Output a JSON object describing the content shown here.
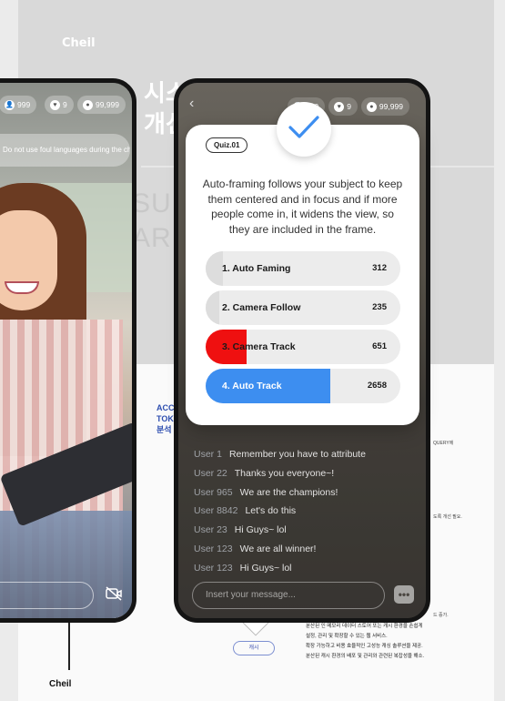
{
  "document": {
    "logo": "Cheil",
    "title_lines": [
      "시스",
      "개선"
    ],
    "title_faded_lines": [
      "SUM",
      "ARD"
    ],
    "section_title_lines": [
      "ACC",
      "TOK",
      "분석"
    ],
    "right_notes": [
      "",
      "QUERY에",
      "",
      "",
      "도록 개선 필요.",
      "",
      "",
      "",
      "",
      "드 증가."
    ],
    "bottom_lines": [
      {
        "text": "?",
        "highlight": true
      },
      {
        "text": "분산된 인 메모리 데이터 스토어 또는 캐시 환경을 손쉽게",
        "highlight": false
      },
      {
        "text": "설정, 관리 및 확장할 수 있는 웹 서비스.",
        "highlight": false
      },
      {
        "text": "확장 가능하고 비용 효율적인 고성능 캐싱 솔루션을 제공.",
        "highlight": false
      },
      {
        "text": "분산된 캐시 환경의 배포 및 관리와 관련된 복잡성을 해소.",
        "highlight": false
      }
    ],
    "chip_label": "캐시",
    "footer": "Cheil"
  },
  "left_phone": {
    "stats": [
      {
        "icon": "user-icon",
        "glyph": "👤",
        "value": "999"
      },
      {
        "icon": "heart-icon",
        "glyph": "♥",
        "value": "9"
      },
      {
        "icon": "coin-icon",
        "glyph": "●",
        "value": "99,999"
      }
    ],
    "notice": "Do not use foul languages during the chat."
  },
  "right_phone": {
    "back_glyph": "‹",
    "stats": [
      {
        "icon": "user-icon",
        "glyph": "👤",
        "value": "999"
      },
      {
        "icon": "heart-icon",
        "glyph": "♥",
        "value": "9"
      },
      {
        "icon": "coin-icon",
        "glyph": "●",
        "value": "99,999"
      }
    ],
    "chat": [
      {
        "user": "User 1",
        "message": "Remember you have to attribute"
      },
      {
        "user": "User 22",
        "message": "Thanks you everyone~!"
      },
      {
        "user": "User 965",
        "message": "We are the champions!"
      },
      {
        "user": "User 8842",
        "message": "Let's do this"
      },
      {
        "user": "User 23",
        "message": "Hi Guys~ lol"
      },
      {
        "user": "User 123",
        "message": "We are all winner!"
      },
      {
        "user": "User 123",
        "message": "Hi Guys~ lol"
      }
    ],
    "input_placeholder": "Insert your message...",
    "chat_icon_glyph": "•••"
  },
  "quiz": {
    "tag": "Quiz.01",
    "question": "Auto-framing follows your subject to keep them centered and in focus and if more people come in, it widens the view, so they are included in the frame.",
    "options": [
      {
        "label": "1. Auto Faming",
        "count": "312",
        "share": 0.09,
        "color": "#dddddd",
        "winner": false
      },
      {
        "label": "2. Camera Follow",
        "count": "235",
        "share": 0.07,
        "color": "#dddddd",
        "winner": false
      },
      {
        "label": "3. Camera Track",
        "count": "651",
        "share": 0.21,
        "color": "#ef1010",
        "winner": false
      },
      {
        "label": "4. Auto Track",
        "count": "2658",
        "share": 0.64,
        "color": "#3d8ef0",
        "winner": true
      }
    ]
  }
}
